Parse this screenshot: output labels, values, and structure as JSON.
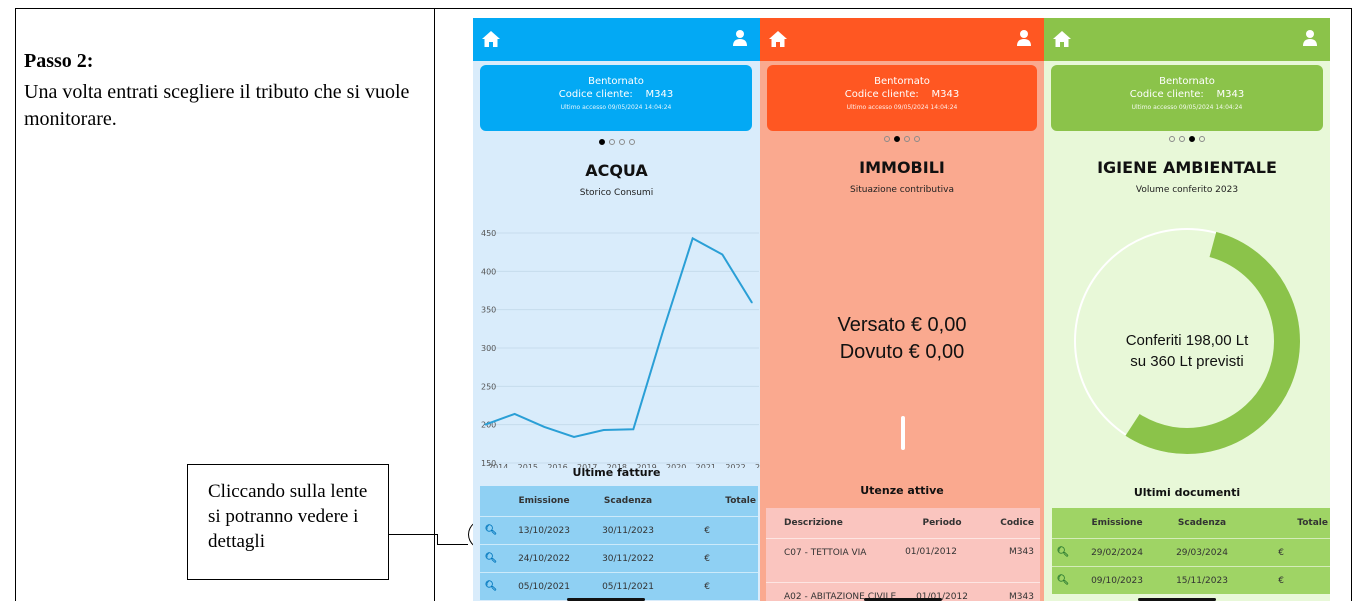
{
  "doc": {
    "step_title": "Passo 2:",
    "step_text": "Una volta entrati scegliere il tributo che si vuole monitorare.",
    "callout": "Cliccando sulla lente si potranno vedere i dettagli"
  },
  "common": {
    "welcome_line1": "Bentornato",
    "welcome_label": "Codice cliente:",
    "client_code": "M343",
    "last_access": "Ultimo accesso 09/05/2024 14:04:24"
  },
  "colors": {
    "water": "#03a9f4",
    "property": "#ff5722",
    "waste": "#8bc34a"
  },
  "water": {
    "title": "ACQUA",
    "subtitle": "Storico Consumi",
    "invoices_title": "Ultime fatture",
    "headers": [
      "Emissione",
      "Scadenza",
      "Totale"
    ],
    "rows": [
      {
        "emission": "13/10/2023",
        "due": "30/11/2023",
        "total": "€"
      },
      {
        "emission": "24/10/2022",
        "due": "30/11/2022",
        "total": "€"
      },
      {
        "emission": "05/10/2021",
        "due": "05/11/2021",
        "total": "€"
      }
    ]
  },
  "property": {
    "title": "IMMOBILI",
    "subtitle": "Situazione contributiva",
    "paid": "Versato € 0,00",
    "due": "Dovuto € 0,00",
    "utilities_title": "Utenze attive",
    "headers": [
      "Descrizione",
      "Periodo",
      "Codice"
    ],
    "rows": [
      {
        "desc": "C07 - TETTOIA VIA",
        "period": "01/01/2012",
        "code": "M343"
      },
      {
        "desc": "A02 - ABITAZIONE CIVILE",
        "period": "01/01/2012",
        "code": "M343"
      }
    ]
  },
  "waste": {
    "title": "IGIENE AMBIENTALE",
    "subtitle": "Volume conferito 2023",
    "center_line1": "Conferiti 198,00 Lt",
    "center_line2": "su 360 Lt previsti",
    "conferred": 198,
    "expected": 360,
    "docs_title": "Ultimi documenti",
    "headers": [
      "Emissione",
      "Scadenza",
      "Totale"
    ],
    "rows": [
      {
        "emission": "29/02/2024",
        "due": "29/03/2024",
        "total": "€"
      },
      {
        "emission": "09/10/2023",
        "due": "15/11/2023",
        "total": "€"
      }
    ]
  },
  "chart_data": {
    "type": "line",
    "x": [
      "2014",
      "2015",
      "2016",
      "2017",
      "2018",
      "2019",
      "2020",
      "2021",
      "2022",
      "2023"
    ],
    "y": [
      200,
      214,
      197,
      184,
      193,
      194,
      322,
      443,
      422,
      359
    ],
    "ylim": [
      150,
      450
    ],
    "yticks": [
      150,
      200,
      250,
      300,
      350,
      400,
      450
    ],
    "xtick_labels": [
      "2014",
      "2015",
      "2016",
      "2017",
      "2018",
      "2019",
      "2020",
      "2021",
      "2022",
      "20"
    ],
    "line_color": "#2a9fd6",
    "grid": true
  }
}
